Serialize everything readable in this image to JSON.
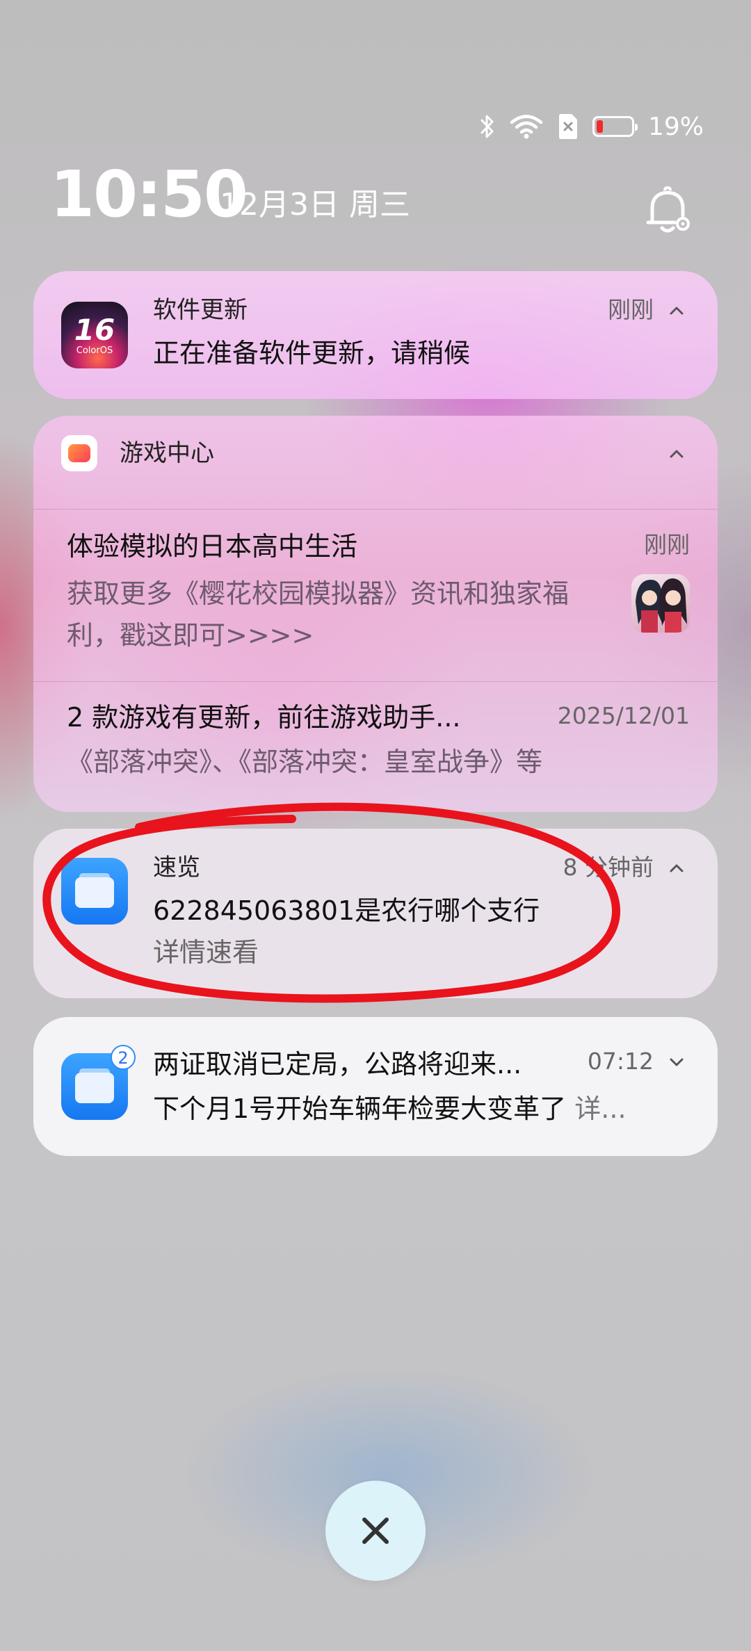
{
  "status_bar": {
    "battery_percent": "19%",
    "battery_level": 0.19,
    "battery_fill_color": "#ef2b2b",
    "icons": [
      "bluetooth-icon",
      "wifi-icon",
      "sim-card-off-icon",
      "battery-icon"
    ]
  },
  "lockscreen": {
    "time": "10:50",
    "date": "12月3日 周三"
  },
  "notifications": {
    "software_update": {
      "icon": "coloros-16-icon",
      "icon_text": "16",
      "icon_subtext": "ColorOS",
      "app": "软件更新",
      "time": "刚刚",
      "title": "正在准备软件更新，请稍候"
    },
    "game_center": {
      "icon": "game-controller-icon",
      "app": "游戏中心",
      "items": [
        {
          "title": "体验模拟的日本高中生活",
          "time": "刚刚",
          "body_line1": "获取更多《樱花校园模拟器》资讯和独家福",
          "body_line2": "利，戳这即可>>>>",
          "thumbnail": "anime-girls-thumbnail"
        },
        {
          "title": "2 款游戏有更新，前往游戏助手...",
          "time": "2025/12/01",
          "body": "《部落冲突》、《部落冲突：皇室战争》等"
        }
      ]
    },
    "sulan": {
      "icon": "sulan-browser-icon",
      "app": "速览",
      "time": "8 分钟前",
      "title": "622845063801是农行哪个支行",
      "subtitle": "详情速看"
    },
    "news_group": {
      "icon": "sulan-browser-icon",
      "badge_count": "2",
      "title": "两证取消已定局，公路将迎来...",
      "time": "07:12",
      "body": "下个月1号开始车辆年检要大变革了",
      "body_suffix": "详..."
    }
  },
  "colors": {
    "annotation_red": "#e8131c",
    "accent_blue": "#1677f2"
  }
}
